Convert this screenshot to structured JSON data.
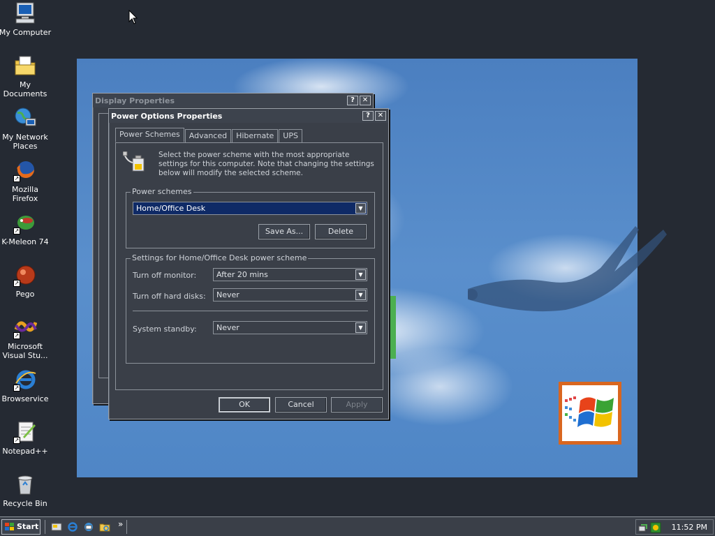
{
  "desktop": {
    "icons": [
      {
        "label": "My Computer",
        "icon": "my-computer-icon"
      },
      {
        "label": "My Documents",
        "icon": "my-documents-icon"
      },
      {
        "label": "My Network Places",
        "icon": "network-places-icon"
      },
      {
        "label": "Mozilla Firefox",
        "icon": "firefox-icon"
      },
      {
        "label": "K-Meleon 74",
        "icon": "kmeleon-icon"
      },
      {
        "label": "Pego",
        "icon": "pego-icon"
      },
      {
        "label": "Microsoft Visual Stu...",
        "icon": "visual-studio-icon"
      },
      {
        "label": "Browservice",
        "icon": "ie-icon"
      },
      {
        "label": "Notepad++",
        "icon": "notepadpp-icon"
      },
      {
        "label": "Recycle Bin",
        "icon": "recycle-bin-icon"
      }
    ]
  },
  "display_window": {
    "title": "Display Properties",
    "help": "?",
    "close": "✕"
  },
  "power_window": {
    "title": "Power Options Properties",
    "help": "?",
    "close": "✕",
    "tabs": [
      "Power Schemes",
      "Advanced",
      "Hibernate",
      "UPS"
    ],
    "intro": "Select the power scheme with the most appropriate settings for this computer. Note that changing the settings below will modify the selected scheme.",
    "schemes_group": "Power schemes",
    "scheme_value": "Home/Office Desk",
    "save_as": "Save As...",
    "delete": "Delete",
    "settings_group": "Settings for Home/Office Desk power scheme",
    "monitor_label": "Turn off monitor:",
    "monitor_value": "After 20 mins",
    "disks_label": "Turn off hard disks:",
    "disks_value": "Never",
    "standby_label": "System standby:",
    "standby_value": "Never",
    "ok": "OK",
    "cancel": "Cancel",
    "apply": "Apply"
  },
  "taskbar": {
    "start": "Start",
    "chevron": "»",
    "clock": "11:52 PM"
  },
  "colors": {
    "desktop_bg": "#252a33",
    "window_bg": "#3a3f48",
    "selection": "#0f2a66",
    "logo_border": "#d9661f"
  }
}
